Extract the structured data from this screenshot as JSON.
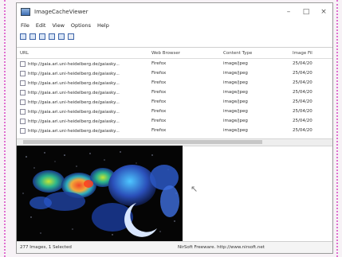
{
  "window": {
    "title": "ImageCacheViewer",
    "controls": {
      "minimize": "–",
      "maximize": "□",
      "close": "×"
    }
  },
  "menu": [
    "File",
    "Edit",
    "View",
    "Options",
    "Help"
  ],
  "toolbar": {
    "icons": [
      "save-icon",
      "copy-icon",
      "properties-icon",
      "refresh-icon",
      "report-icon",
      "exit-icon"
    ]
  },
  "table": {
    "headers": [
      "URL",
      "Web Browser",
      "Content Type",
      "Image Fil"
    ],
    "rows": [
      {
        "url": "http://gaia.ari.uni-heidelberg.de/gaiasky...",
        "browser": "Firefox",
        "type": "image/jpeg",
        "date": "25/04/20"
      },
      {
        "url": "http://gaia.ari.uni-heidelberg.de/gaiasky...",
        "browser": "Firefox",
        "type": "image/jpeg",
        "date": "25/04/20"
      },
      {
        "url": "http://gaia.ari.uni-heidelberg.de/gaiasky...",
        "browser": "Firefox",
        "type": "image/jpeg",
        "date": "25/04/20"
      },
      {
        "url": "http://gaia.ari.uni-heidelberg.de/gaiasky...",
        "browser": "Firefox",
        "type": "image/jpeg",
        "date": "25/04/20"
      },
      {
        "url": "http://gaia.ari.uni-heidelberg.de/gaiasky...",
        "browser": "Firefox",
        "type": "image/jpeg",
        "date": "25/04/20"
      },
      {
        "url": "http://gaia.ari.uni-heidelberg.de/gaiasky...",
        "browser": "Firefox",
        "type": "image/jpeg",
        "date": "25/04/20"
      },
      {
        "url": "http://gaia.ari.uni-heidelberg.de/gaiasky...",
        "browser": "Firefox",
        "type": "image/jpeg",
        "date": "25/04/20"
      },
      {
        "url": "http://gaia.ari.uni-heidelberg.de/gaiasky...",
        "browser": "Firefox",
        "type": "image/jpeg",
        "date": "25/04/20"
      }
    ]
  },
  "status": {
    "left": "277 Images, 1 Selected",
    "right": "NirSoft Freeware.  http://www.nirsoft.net"
  }
}
